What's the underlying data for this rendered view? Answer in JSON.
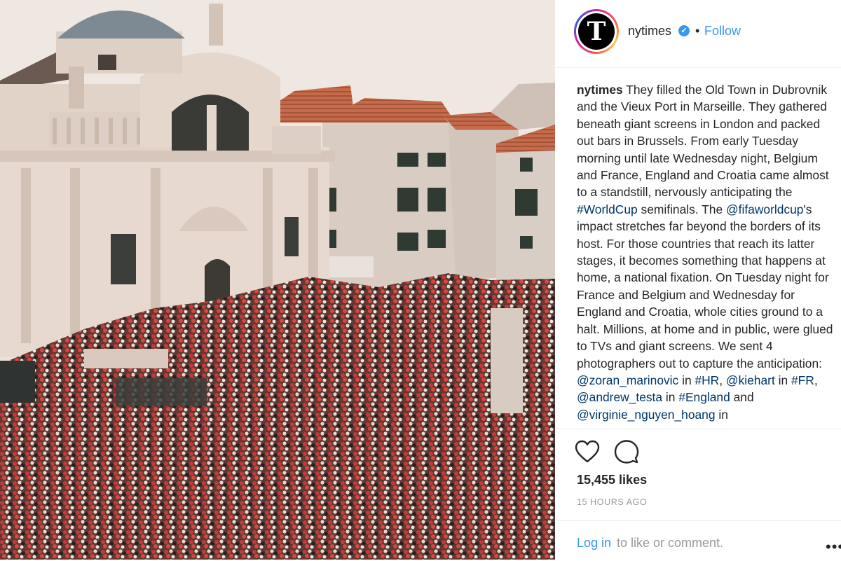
{
  "post": {
    "username": "nytimes",
    "avatar_letter": "T",
    "verified_glyph": "✓",
    "separator": "•",
    "follow_label": "Follow",
    "caption": {
      "username": "nytimes",
      "text_1": " They filled the Old Town in Dubrovnik and the Vieux Port in Marseille. They gathered beneath giant screens in London and packed out bars in Brussels. From early Tuesday morning until late Wednesday night, Belgium and France, England and Croatia came almost to a standstill, nervously anticipating the ",
      "hashtag_worldcup": "#WorldCup",
      "text_2": " semifinals. The ",
      "mention_fifa": "@fifaworldcup",
      "text_3": "'s impact stretches far beyond the borders of its host. For those countries that reach its latter stages, it becomes something that happens at home, a national fixation. On Tuesday night for France and Belgium and Wednesday for England and Croatia, whole cities ground to a halt. Millions, at home and in public, were glued to TVs and giant screens. We sent 4 photographers out to capture the anticipation: ",
      "mention_zoran": "@zoran_marinovic",
      "text_4": " in ",
      "hashtag_hr": "#HR",
      "text_5": ", ",
      "mention_kiehart": "@kiehart",
      "text_6": " in ",
      "hashtag_fr": "#FR",
      "text_7": ", ",
      "mention_testa": "@andrew_testa",
      "text_8": " in ",
      "hashtag_england": "#England",
      "text_9": " and ",
      "mention_virginie": "@virginie_nguyen_hoang",
      "text_10": " in"
    },
    "likes": "15,455 likes",
    "time": "15 HOURS AGO",
    "login_label": "Log in",
    "login_rest": " to like or comment.",
    "more_label": "•••"
  },
  "icons": {
    "heart": "heart-icon",
    "comment": "comment-icon",
    "more": "more-options-icon",
    "verified": "verified-badge-icon"
  },
  "colors": {
    "link": "#3897f0",
    "caption_link": "#003569",
    "text": "#262626",
    "muted": "#999999"
  }
}
